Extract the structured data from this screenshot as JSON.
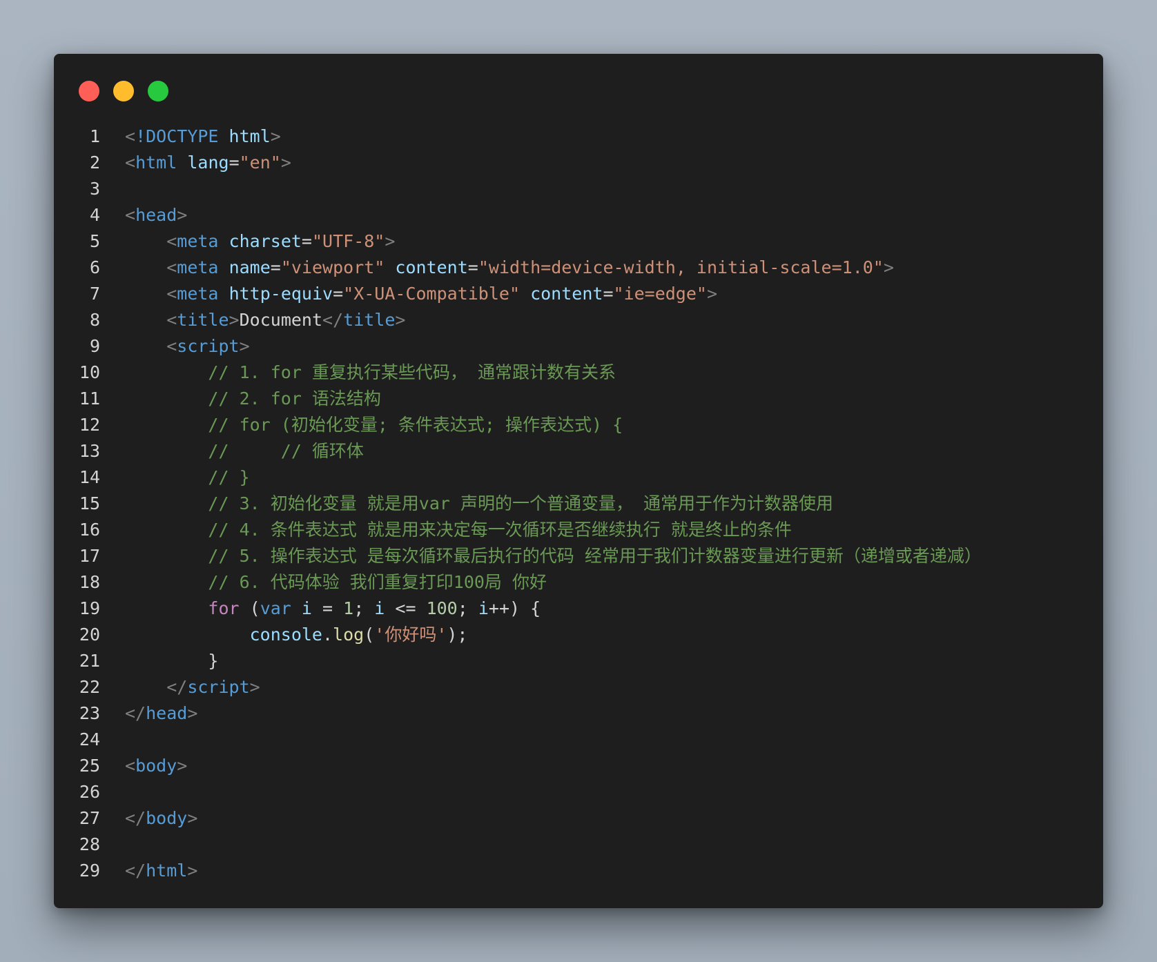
{
  "window": {
    "controls": [
      {
        "name": "close",
        "color": "#ff5f56"
      },
      {
        "name": "minimize",
        "color": "#ffbd2e"
      },
      {
        "name": "maximize",
        "color": "#27c93f"
      }
    ]
  },
  "editor": {
    "lines": [
      {
        "n": "1",
        "tokens": [
          [
            "bracket",
            "<"
          ],
          [
            "tag",
            "!DOCTYPE"
          ],
          [
            "text",
            " "
          ],
          [
            "attr",
            "html"
          ],
          [
            "bracket",
            ">"
          ]
        ]
      },
      {
        "n": "2",
        "tokens": [
          [
            "bracket",
            "<"
          ],
          [
            "tag",
            "html"
          ],
          [
            "text",
            " "
          ],
          [
            "attr",
            "lang"
          ],
          [
            "text",
            "="
          ],
          [
            "string",
            "\"en\""
          ],
          [
            "bracket",
            ">"
          ]
        ]
      },
      {
        "n": "3",
        "tokens": []
      },
      {
        "n": "4",
        "tokens": [
          [
            "bracket",
            "<"
          ],
          [
            "tag",
            "head"
          ],
          [
            "bracket",
            ">"
          ]
        ]
      },
      {
        "n": "5",
        "tokens": [
          [
            "text",
            "    "
          ],
          [
            "bracket",
            "<"
          ],
          [
            "tag",
            "meta"
          ],
          [
            "text",
            " "
          ],
          [
            "attr",
            "charset"
          ],
          [
            "text",
            "="
          ],
          [
            "string",
            "\"UTF-8\""
          ],
          [
            "bracket",
            ">"
          ]
        ]
      },
      {
        "n": "6",
        "tokens": [
          [
            "text",
            "    "
          ],
          [
            "bracket",
            "<"
          ],
          [
            "tag",
            "meta"
          ],
          [
            "text",
            " "
          ],
          [
            "attr",
            "name"
          ],
          [
            "text",
            "="
          ],
          [
            "string",
            "\"viewport\""
          ],
          [
            "text",
            " "
          ],
          [
            "attr",
            "content"
          ],
          [
            "text",
            "="
          ],
          [
            "string",
            "\"width=device-width, initial-scale=1.0\""
          ],
          [
            "bracket",
            ">"
          ]
        ]
      },
      {
        "n": "7",
        "tokens": [
          [
            "text",
            "    "
          ],
          [
            "bracket",
            "<"
          ],
          [
            "tag",
            "meta"
          ],
          [
            "text",
            " "
          ],
          [
            "attr",
            "http-equiv"
          ],
          [
            "text",
            "="
          ],
          [
            "string",
            "\"X-UA-Compatible\""
          ],
          [
            "text",
            " "
          ],
          [
            "attr",
            "content"
          ],
          [
            "text",
            "="
          ],
          [
            "string",
            "\"ie=edge\""
          ],
          [
            "bracket",
            ">"
          ]
        ]
      },
      {
        "n": "8",
        "tokens": [
          [
            "text",
            "    "
          ],
          [
            "bracket",
            "<"
          ],
          [
            "tag",
            "title"
          ],
          [
            "bracket",
            ">"
          ],
          [
            "text",
            "Document"
          ],
          [
            "bracket",
            "</"
          ],
          [
            "tag",
            "title"
          ],
          [
            "bracket",
            ">"
          ]
        ]
      },
      {
        "n": "9",
        "tokens": [
          [
            "text",
            "    "
          ],
          [
            "bracket",
            "<"
          ],
          [
            "tag",
            "script"
          ],
          [
            "bracket",
            ">"
          ]
        ]
      },
      {
        "n": "10",
        "tokens": [
          [
            "text",
            "        "
          ],
          [
            "comment",
            "// 1. for 重复执行某些代码， 通常跟计数有关系"
          ]
        ]
      },
      {
        "n": "11",
        "tokens": [
          [
            "text",
            "        "
          ],
          [
            "comment",
            "// 2. for 语法结构"
          ]
        ]
      },
      {
        "n": "12",
        "tokens": [
          [
            "text",
            "        "
          ],
          [
            "comment",
            "// for (初始化变量; 条件表达式; 操作表达式) {"
          ]
        ]
      },
      {
        "n": "13",
        "tokens": [
          [
            "text",
            "        "
          ],
          [
            "comment",
            "//     // 循环体"
          ]
        ]
      },
      {
        "n": "14",
        "tokens": [
          [
            "text",
            "        "
          ],
          [
            "comment",
            "// }"
          ]
        ]
      },
      {
        "n": "15",
        "tokens": [
          [
            "text",
            "        "
          ],
          [
            "comment",
            "// 3. 初始化变量 就是用var 声明的一个普通变量， 通常用于作为计数器使用"
          ]
        ]
      },
      {
        "n": "16",
        "tokens": [
          [
            "text",
            "        "
          ],
          [
            "comment",
            "// 4. 条件表达式 就是用来决定每一次循环是否继续执行 就是终止的条件"
          ]
        ]
      },
      {
        "n": "17",
        "tokens": [
          [
            "text",
            "        "
          ],
          [
            "comment",
            "// 5. 操作表达式 是每次循环最后执行的代码 经常用于我们计数器变量进行更新（递增或者递减）"
          ]
        ]
      },
      {
        "n": "18",
        "tokens": [
          [
            "text",
            "        "
          ],
          [
            "comment",
            "// 6. 代码体验 我们重复打印100局 你好"
          ]
        ]
      },
      {
        "n": "19",
        "tokens": [
          [
            "text",
            "        "
          ],
          [
            "control",
            "for"
          ],
          [
            "text",
            " ("
          ],
          [
            "keyword",
            "var"
          ],
          [
            "text",
            " "
          ],
          [
            "var",
            "i"
          ],
          [
            "text",
            " = "
          ],
          [
            "num",
            "1"
          ],
          [
            "text",
            "; "
          ],
          [
            "var",
            "i"
          ],
          [
            "text",
            " <= "
          ],
          [
            "num",
            "100"
          ],
          [
            "text",
            "; "
          ],
          [
            "var",
            "i"
          ],
          [
            "text",
            "++) {"
          ]
        ]
      },
      {
        "n": "20",
        "tokens": [
          [
            "text",
            "            "
          ],
          [
            "var",
            "console"
          ],
          [
            "text",
            "."
          ],
          [
            "func",
            "log"
          ],
          [
            "text",
            "("
          ],
          [
            "string",
            "'你好吗'"
          ],
          [
            "text",
            ");"
          ]
        ]
      },
      {
        "n": "21",
        "tokens": [
          [
            "text",
            "        }"
          ]
        ]
      },
      {
        "n": "22",
        "tokens": [
          [
            "text",
            "    "
          ],
          [
            "bracket",
            "</"
          ],
          [
            "tag",
            "script"
          ],
          [
            "bracket",
            ">"
          ]
        ]
      },
      {
        "n": "23",
        "tokens": [
          [
            "bracket",
            "</"
          ],
          [
            "tag",
            "head"
          ],
          [
            "bracket",
            ">"
          ]
        ]
      },
      {
        "n": "24",
        "tokens": []
      },
      {
        "n": "25",
        "tokens": [
          [
            "bracket",
            "<"
          ],
          [
            "tag",
            "body"
          ],
          [
            "bracket",
            ">"
          ]
        ]
      },
      {
        "n": "26",
        "tokens": []
      },
      {
        "n": "27",
        "tokens": [
          [
            "bracket",
            "</"
          ],
          [
            "tag",
            "body"
          ],
          [
            "bracket",
            ">"
          ]
        ]
      },
      {
        "n": "28",
        "tokens": []
      },
      {
        "n": "29",
        "tokens": [
          [
            "bracket",
            "</"
          ],
          [
            "tag",
            "html"
          ],
          [
            "bracket",
            ">"
          ]
        ]
      }
    ]
  }
}
